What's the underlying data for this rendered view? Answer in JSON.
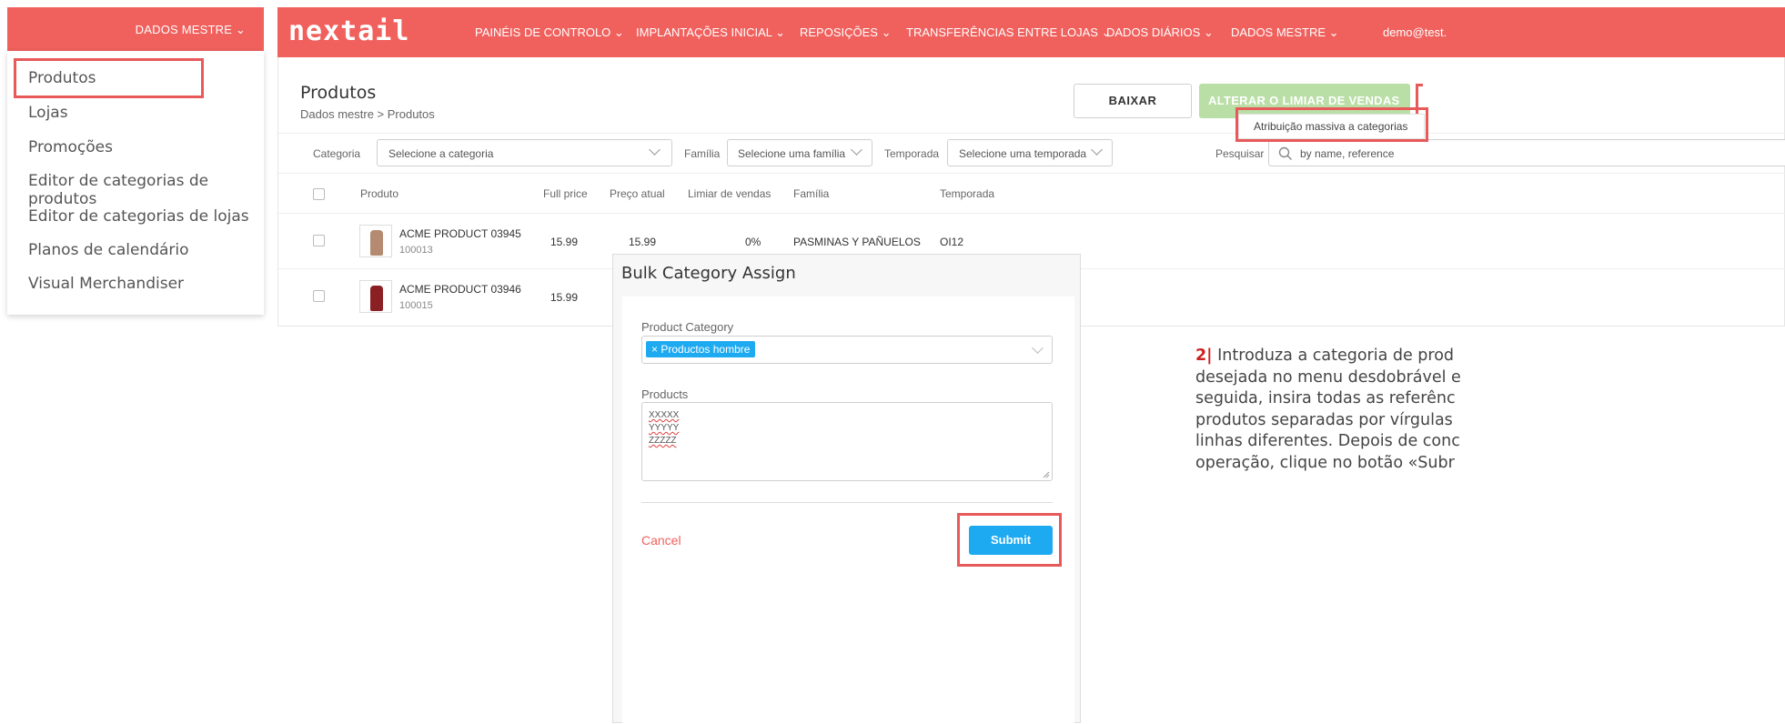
{
  "left_dropdown": {
    "trigger_label": "DADOS MESTRE",
    "items": [
      {
        "label": "Produtos"
      },
      {
        "label": "Lojas"
      },
      {
        "label": "Promoções"
      },
      {
        "label": "Editor de categorias de produtos"
      },
      {
        "label": "Editor de categorias de lojas"
      },
      {
        "label": "Planos de calendário"
      },
      {
        "label": "Visual Merchandiser"
      }
    ]
  },
  "navbar": {
    "logo": "nextail",
    "items": [
      {
        "label": "PAINÉIS DE CONTROLO"
      },
      {
        "label": "IMPLANTAÇÕES INICIAL"
      },
      {
        "label": "REPOSIÇÕES"
      },
      {
        "label": "TRANSFERÊNCIAS ENTRE LOJAS"
      },
      {
        "label": "DADOS DIÁRIOS"
      },
      {
        "label": "DADOS MESTRE"
      }
    ],
    "user": "demo@test."
  },
  "page": {
    "title": "Produtos",
    "breadcrumb": "Dados mestre > Produtos",
    "download_button": "BAIXAR",
    "threshold_button": "ALTERAR O LIMIAR DE VENDAS",
    "more_menu_item": "Atribuição massiva a categorias"
  },
  "filters": {
    "category_label": "Categoria",
    "category_placeholder": "Selecione a categoria",
    "family_label": "Família",
    "family_placeholder": "Selecione uma família",
    "season_label": "Temporada",
    "season_placeholder": "Selecione uma temporada",
    "search_label": "Pesquisar",
    "search_placeholder": "by name, reference"
  },
  "table": {
    "columns": [
      "Produto",
      "Full price",
      "Preço atual",
      "Limiar de vendas",
      "Família",
      "Temporada"
    ],
    "rows": [
      {
        "name": "ACME PRODUCT 03945",
        "ref": "100013",
        "full_price": "15.99",
        "current_price": "15.99",
        "threshold": "0%",
        "family": "PASMINAS Y PAÑUELOS",
        "season": "OI12"
      },
      {
        "name": "ACME PRODUCT 03946",
        "ref": "100015",
        "full_price": "15.99"
      }
    ]
  },
  "modal": {
    "title": "Bulk Category Assign",
    "category_label": "Product Category",
    "category_tag": "Productos hombre",
    "products_label": "Products",
    "products_lines": [
      "XXXXX",
      "YYYYY",
      "ZZZZZ"
    ],
    "cancel": "Cancel",
    "submit": "Submit"
  },
  "instructions": {
    "step": "2|",
    "lines": [
      " Introduza a categoria de prod",
      "desejada no menu desdobrável e",
      "seguida, insira todas as referênc",
      "produtos separadas por vírgulas",
      "linhas diferentes. Depois de conc",
      "operação, clique no botão «Subr"
    ]
  },
  "colors": {
    "brand_red": "#f0605d",
    "highlight_red": "#e8595a",
    "primary_blue": "#1eaaf1",
    "threshold_green": "#b9dea6"
  }
}
